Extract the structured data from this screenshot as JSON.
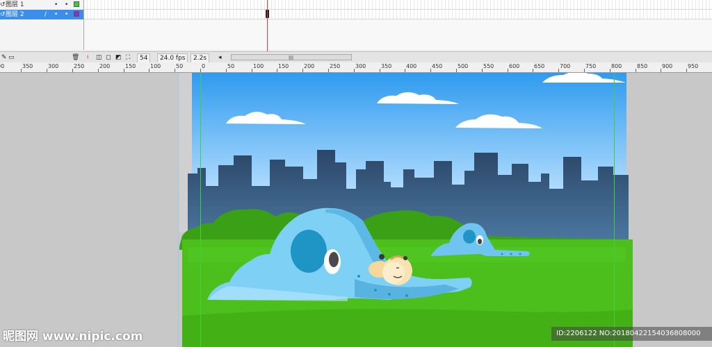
{
  "timeline": {
    "layers": [
      {
        "name": "图层 1",
        "icon": "↺",
        "dot1": "•",
        "dot2": "•",
        "color": "#3ccf3c",
        "selected": false
      },
      {
        "name": "图层 2",
        "icon": "↺",
        "pencil": "/",
        "dot1": "•",
        "dot2": "•",
        "color": "#8a2be2",
        "selected": true
      }
    ],
    "toolbar": {
      "current_frame": "54",
      "frame_rate": "24.0 fps",
      "elapsed_time": "2.2s",
      "scroll_left_arrow": "◂",
      "scroll_grip": "III"
    }
  },
  "ruler": {
    "labels": [
      "00",
      "350",
      "300",
      "250",
      "200",
      "150",
      "100",
      "50",
      "0",
      "50",
      "100",
      "150",
      "200",
      "250",
      "300",
      "350",
      "400",
      "450",
      "500",
      "550",
      "600",
      "650",
      "700",
      "750",
      "800",
      "850",
      "900",
      "950"
    ]
  },
  "watermark": {
    "logo": "昵图网 www.nipic.com",
    "id_text": "ID:2206122 NO:20180422154036808000"
  },
  "colors": {
    "sky_top": "#2f9bef",
    "sky_bottom": "#e6f3ff",
    "city": "#2c4b6d",
    "grass": "#4cbf1c",
    "slide": "#7fd0f5",
    "layer2_swatch": "#8a2be2",
    "layer1_swatch": "#3ccf3c"
  }
}
